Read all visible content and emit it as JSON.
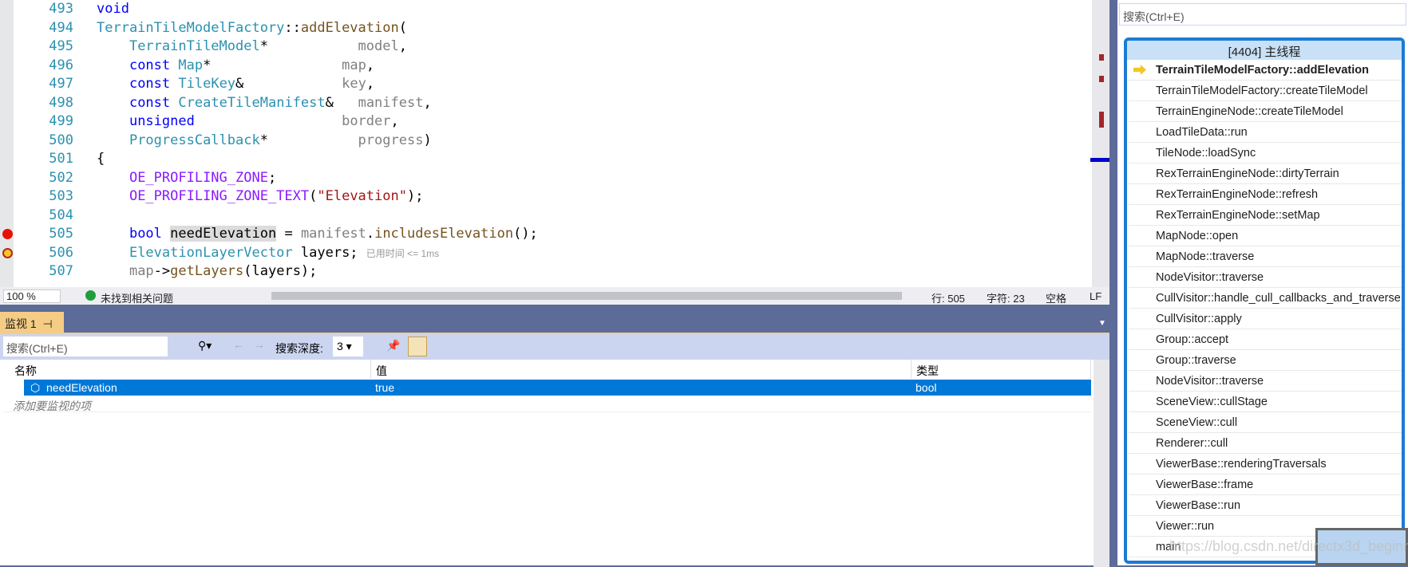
{
  "editor": {
    "lines": [
      {
        "n": "493",
        "parts": [
          [
            "kw",
            "void"
          ]
        ]
      },
      {
        "n": "494",
        "parts": [
          [
            "ty",
            "TerrainTileModelFactory"
          ],
          [
            "tx",
            "::"
          ],
          [
            "fn",
            "addElevation"
          ],
          [
            "tx",
            "("
          ]
        ]
      },
      {
        "n": "495",
        "parts": [
          [
            "tx",
            "    "
          ],
          [
            "ty",
            "TerrainTileModel"
          ],
          [
            "tx",
            "*           "
          ],
          [
            "par",
            "model"
          ],
          [
            "tx",
            ","
          ]
        ]
      },
      {
        "n": "496",
        "parts": [
          [
            "tx",
            "    "
          ],
          [
            "kw",
            "const"
          ],
          [
            "tx",
            " "
          ],
          [
            "ty",
            "Map"
          ],
          [
            "tx",
            "*                "
          ],
          [
            "par",
            "map"
          ],
          [
            "tx",
            ","
          ]
        ]
      },
      {
        "n": "497",
        "parts": [
          [
            "tx",
            "    "
          ],
          [
            "kw",
            "const"
          ],
          [
            "tx",
            " "
          ],
          [
            "ty",
            "TileKey"
          ],
          [
            "tx",
            "&            "
          ],
          [
            "par",
            "key"
          ],
          [
            "tx",
            ","
          ]
        ]
      },
      {
        "n": "498",
        "parts": [
          [
            "tx",
            "    "
          ],
          [
            "kw",
            "const"
          ],
          [
            "tx",
            " "
          ],
          [
            "ty",
            "CreateTileManifest"
          ],
          [
            "tx",
            "&   "
          ],
          [
            "par",
            "manifest"
          ],
          [
            "tx",
            ","
          ]
        ]
      },
      {
        "n": "499",
        "parts": [
          [
            "tx",
            "    "
          ],
          [
            "kw",
            "unsigned"
          ],
          [
            "tx",
            "                  "
          ],
          [
            "par",
            "border"
          ],
          [
            "tx",
            ","
          ]
        ]
      },
      {
        "n": "500",
        "parts": [
          [
            "tx",
            "    "
          ],
          [
            "ty",
            "ProgressCallback"
          ],
          [
            "tx",
            "*           "
          ],
          [
            "par",
            "progress"
          ],
          [
            "tx",
            ")"
          ]
        ]
      },
      {
        "n": "501",
        "parts": [
          [
            "tx",
            "{"
          ]
        ]
      },
      {
        "n": "502",
        "parts": [
          [
            "tx",
            "    "
          ],
          [
            "mac",
            "OE_PROFILING_ZONE"
          ],
          [
            "tx",
            ";"
          ]
        ]
      },
      {
        "n": "503",
        "parts": [
          [
            "tx",
            "    "
          ],
          [
            "mac",
            "OE_PROFILING_ZONE_TEXT"
          ],
          [
            "tx",
            "("
          ],
          [
            "str",
            "\"Elevation\""
          ],
          [
            "tx",
            ");"
          ]
        ]
      },
      {
        "n": "504",
        "parts": []
      },
      {
        "n": "505",
        "parts": [
          [
            "tx",
            "    "
          ],
          [
            "kw",
            "bool"
          ],
          [
            "tx",
            " "
          ],
          [
            "hl",
            "needElevation"
          ],
          [
            "tx",
            " = "
          ],
          [
            "par",
            "manifest"
          ],
          [
            "tx",
            "."
          ],
          [
            "fn",
            "includesElevation"
          ],
          [
            "tx",
            "();"
          ]
        ]
      },
      {
        "n": "506",
        "parts": [
          [
            "tx",
            "    "
          ],
          [
            "ty",
            "ElevationLayerVector"
          ],
          [
            "tx",
            " layers; "
          ],
          [
            "hint",
            "已用时间 <= 1ms"
          ]
        ]
      },
      {
        "n": "507",
        "parts": [
          [
            "tx",
            "    "
          ],
          [
            "par",
            "map"
          ],
          [
            "tx",
            "->"
          ],
          [
            "fn",
            "getLayers"
          ],
          [
            "tx",
            "(layers);"
          ]
        ]
      }
    ],
    "breakpoint_line": "505",
    "current_line": "506"
  },
  "status": {
    "zoom": "100 %",
    "issues": "未找到相关问题",
    "line": "行: 505",
    "char": "字符: 23",
    "indent": "空格",
    "eol": "LF"
  },
  "watch": {
    "tab_title": "监视 1",
    "search_placeholder": "搜索(Ctrl+E)",
    "depth_label": "搜索深度:",
    "depth_value": "3",
    "columns": [
      "名称",
      "值",
      "类型"
    ],
    "rows": [
      {
        "name": "needElevation",
        "value": "true",
        "type": "bool"
      }
    ],
    "add_placeholder": "添加要监视的项"
  },
  "callstack": {
    "search_placeholder": "搜索(Ctrl+E)",
    "thread": "[4404] 主线程",
    "frames": [
      "TerrainTileModelFactory::addElevation",
      "TerrainTileModelFactory::createTileModel",
      "TerrainEngineNode::createTileModel",
      "LoadTileData::run",
      "TileNode::loadSync",
      "RexTerrainEngineNode::dirtyTerrain",
      "RexTerrainEngineNode::refresh",
      "RexTerrainEngineNode::setMap",
      "MapNode::open",
      "MapNode::traverse",
      "NodeVisitor::traverse",
      "CullVisitor::handle_cull_callbacks_and_traverse",
      "CullVisitor::apply",
      "Group::accept",
      "Group::traverse",
      "NodeVisitor::traverse",
      "SceneView::cullStage",
      "SceneView::cull",
      "Renderer::cull",
      "ViewerBase::renderingTraversals",
      "ViewerBase::frame",
      "ViewerBase::run",
      "Viewer::run",
      "main"
    ]
  },
  "watermark": "https://blog.csdn.net/directx3d_beginner"
}
